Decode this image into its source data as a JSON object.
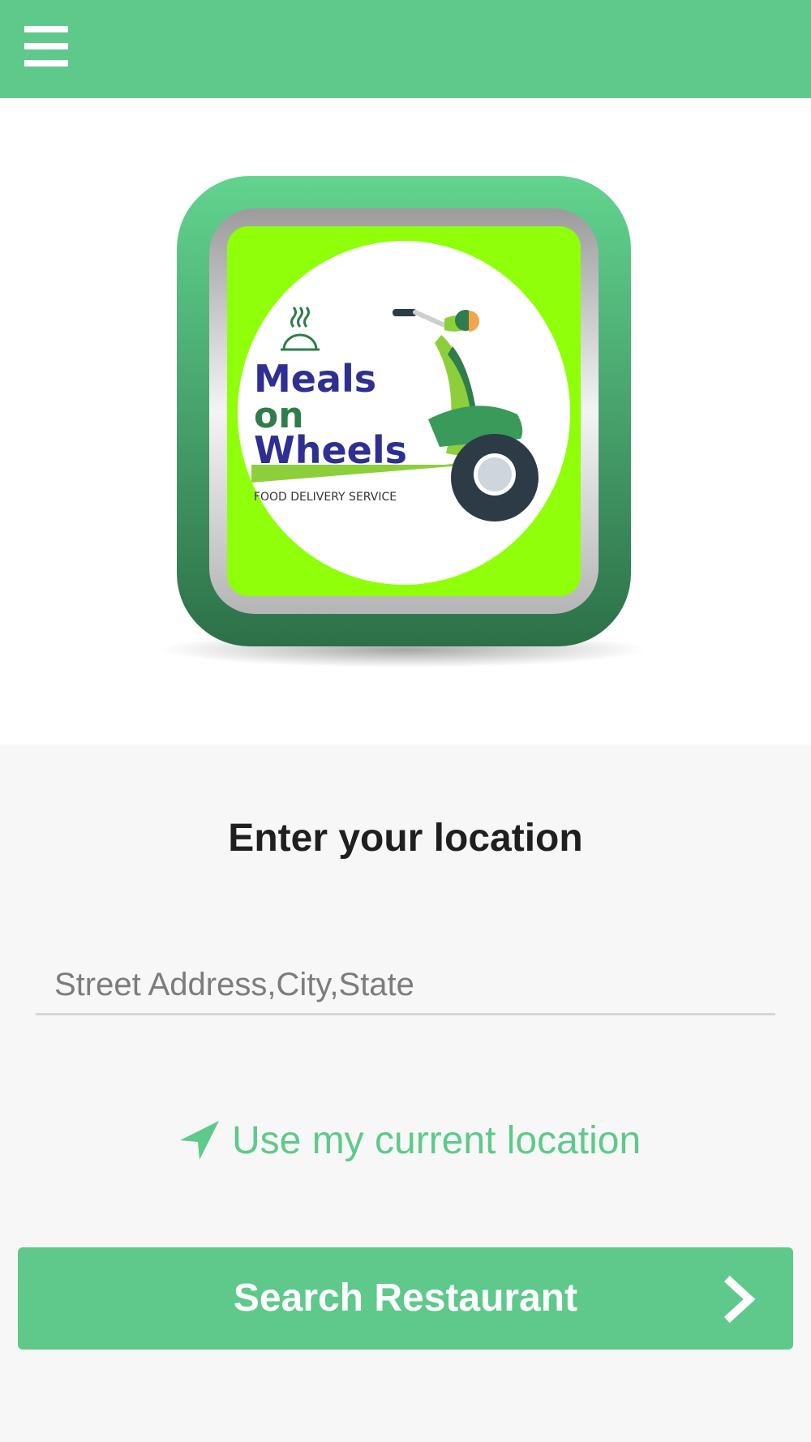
{
  "header": {
    "menu_icon": "hamburger-menu-icon",
    "background_color": "#5ec98b"
  },
  "logo": {
    "title_line1": "Meals",
    "title_line2": "on",
    "title_line3": "Wheels",
    "tagline": "FOOD DELIVERY SERVICE",
    "brand_green": "#5ec98b",
    "lime": "#8fff0a",
    "navy": "#2e2e93"
  },
  "form": {
    "title": "Enter your location",
    "address_placeholder": "Street Address,City,State",
    "address_value": "",
    "current_location_label": "Use my current location",
    "current_location_icon": "location-arrow-icon",
    "search_button_label": "Search Restaurant",
    "search_button_icon": "chevron-right-icon",
    "accent_color": "#5ec98b"
  }
}
